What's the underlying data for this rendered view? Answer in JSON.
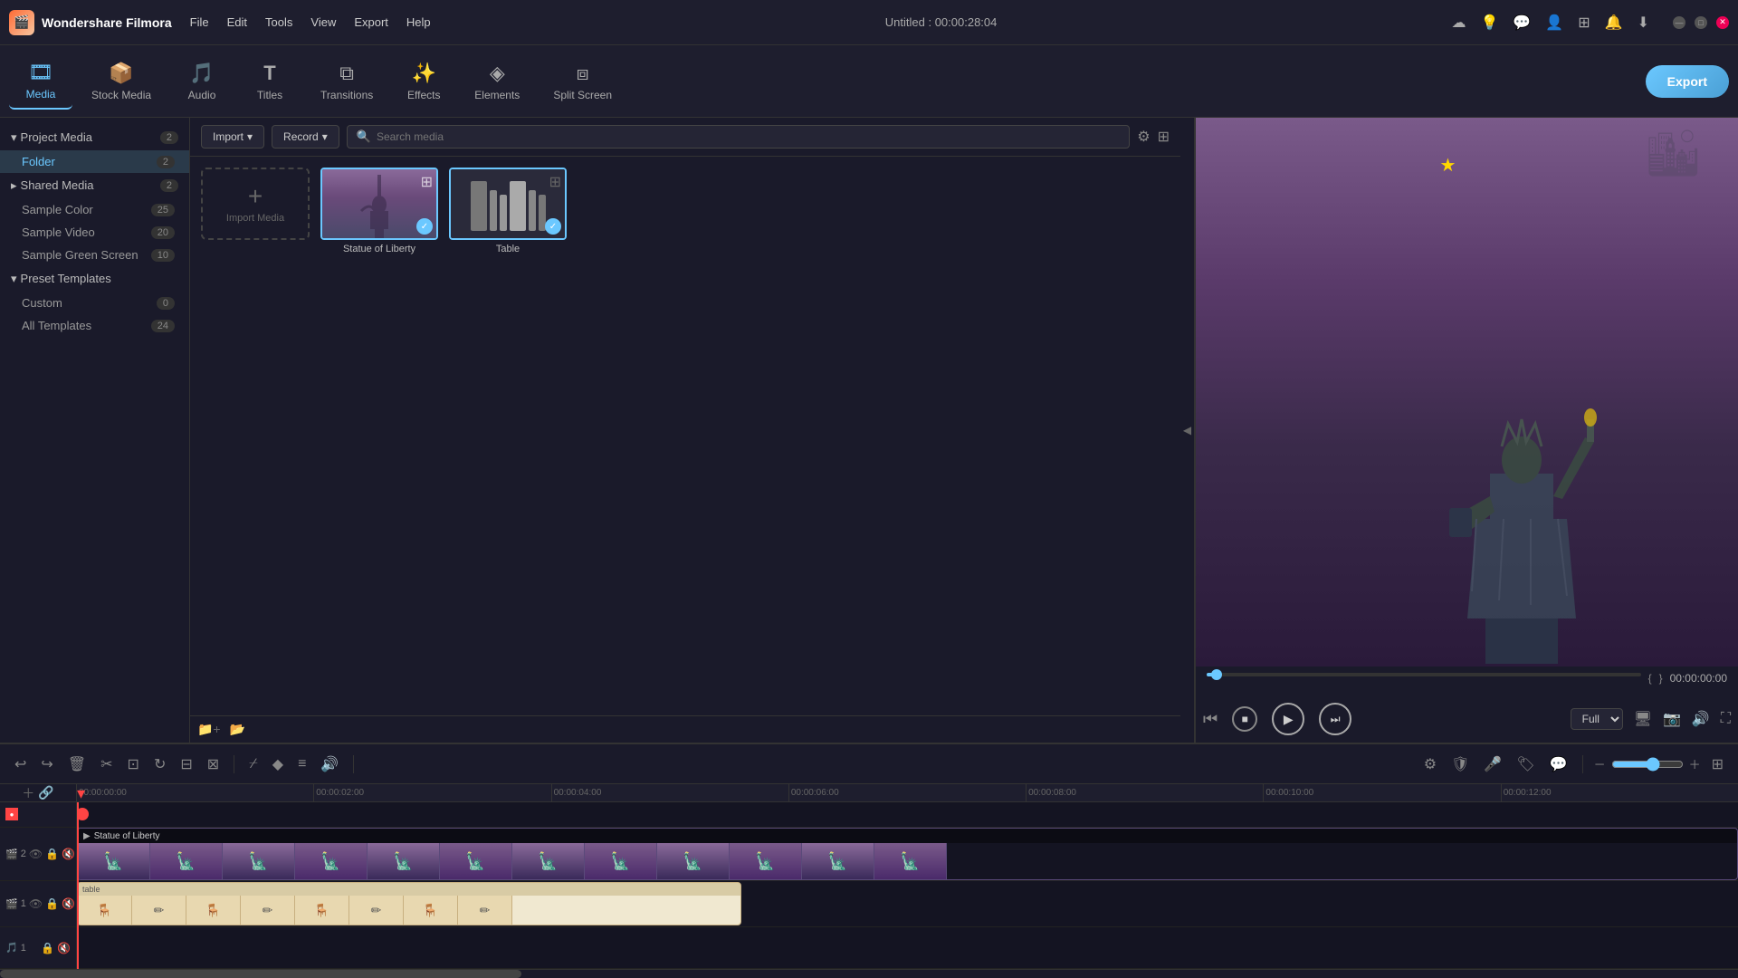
{
  "app": {
    "name": "Wondershare Filmora",
    "title": "Untitled : 00:00:28:04"
  },
  "menu": {
    "items": [
      "File",
      "Edit",
      "Tools",
      "View",
      "Export",
      "Help"
    ]
  },
  "toolbar": {
    "items": [
      {
        "id": "media",
        "label": "Media",
        "icon": "🎞",
        "active": true
      },
      {
        "id": "stock-media",
        "label": "Stock Media",
        "icon": "📦"
      },
      {
        "id": "audio",
        "label": "Audio",
        "icon": "🎵"
      },
      {
        "id": "titles",
        "label": "Titles",
        "icon": "T"
      },
      {
        "id": "transitions",
        "label": "Transitions",
        "icon": "⧉"
      },
      {
        "id": "effects",
        "label": "Effects",
        "icon": "✨"
      },
      {
        "id": "elements",
        "label": "Elements",
        "icon": "◈"
      },
      {
        "id": "split-screen",
        "label": "Split Screen",
        "icon": "⧈"
      }
    ],
    "export_label": "Export"
  },
  "sidebar": {
    "project_media": {
      "label": "Project Media",
      "count": 2,
      "expanded": true
    },
    "folder": {
      "label": "Folder",
      "count": 2
    },
    "shared_media": {
      "label": "Shared Media",
      "count": 2,
      "expanded": false
    },
    "sample_color": {
      "label": "Sample Color",
      "count": 25
    },
    "sample_video": {
      "label": "Sample Video",
      "count": 20
    },
    "sample_green_screen": {
      "label": "Sample Green Screen",
      "count": 10
    },
    "preset_templates": {
      "label": "Preset Templates",
      "expanded": true
    },
    "custom": {
      "label": "Custom",
      "count": 0
    },
    "all_templates": {
      "label": "All Templates",
      "count": 24
    }
  },
  "media": {
    "import_label": "Import",
    "record_label": "Record",
    "search_placeholder": "Search media",
    "items": [
      {
        "id": "import",
        "type": "import",
        "label": "Import Media"
      },
      {
        "id": "sol",
        "type": "video",
        "label": "Statue of Liberty",
        "selected": true
      },
      {
        "id": "table",
        "type": "video",
        "label": "Table",
        "selected": true
      }
    ]
  },
  "preview": {
    "time": "00:00:00:00",
    "quality": "Full",
    "progress_percent": 1
  },
  "timeline": {
    "ruler_marks": [
      "00:00:00:00",
      "00:00:02:00",
      "00:00:04:00",
      "00:00:06:00",
      "00:00:08:00",
      "00:00:10:00",
      "00:00:12:00"
    ],
    "tracks": [
      {
        "id": "v2",
        "type": "video",
        "number": 2,
        "label": "Statue of Liberty",
        "clip_color": "purple"
      },
      {
        "id": "v1",
        "type": "video",
        "number": 1,
        "label": "table",
        "clip_color": "tan"
      },
      {
        "id": "a1",
        "type": "audio",
        "number": 1,
        "label": ""
      }
    ]
  },
  "window_controls": {
    "minimize": "—",
    "maximize": "□",
    "close": "✕"
  }
}
